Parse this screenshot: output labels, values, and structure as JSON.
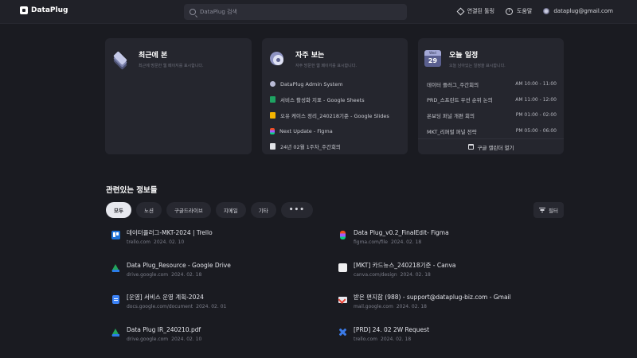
{
  "app": {
    "name": "DataPlug"
  },
  "search": {
    "placeholder": "DataPlug 검색"
  },
  "topnav": {
    "connected_tools": "연결된 툴링",
    "help": "도움말",
    "account": "dataplug@gmail.com"
  },
  "cards": {
    "recent": {
      "title": "최근에 본",
      "subtitle": "최근에 방문한 웹 페이지를 표시합니다."
    },
    "frequent": {
      "title": "자주 보는",
      "subtitle": "자주 방문한 웹 페이지를 표시합니다.",
      "items": [
        {
          "label": "DataPlug Admin System",
          "icon": "system-icon"
        },
        {
          "label": "서비스 활성화 지표 - Google Sheets",
          "icon": "google-sheets-icon"
        },
        {
          "label": "오유 케이스 정리_240218기준 - Google Slides",
          "icon": "google-slides-icon"
        },
        {
          "label": "Next Update - Figma",
          "icon": "figma-icon"
        },
        {
          "label": "24년 02월 1주차_주간회의",
          "icon": "document-icon"
        }
      ]
    },
    "today": {
      "title": "오늘 일정",
      "subtitle": "오늘 남아있는 일정을 표시합니다.",
      "calendar_month": "Wed",
      "calendar_day": "29",
      "events": [
        {
          "name": "데이터 플러그_주간회의",
          "time": "AM 10:00 - 11:00"
        },
        {
          "name": "PRD_스프린트 우선 순위 논의",
          "time": "AM 11:00 - 12:00"
        },
        {
          "name": "온보딩 퍼널 개편 회의",
          "time": "PM 01:00 - 02:00"
        },
        {
          "name": "MKT_리퍼럴 퍼널 전략",
          "time": "PM 05:00 - 06:00"
        }
      ],
      "open_calendar": "구글 캘린더 열기"
    }
  },
  "related": {
    "title": "관련있는 정보들",
    "chips": [
      "모두",
      "노션",
      "구글드라이브",
      "지메일",
      "기타",
      "•••"
    ],
    "active_chip": "모두",
    "filter_label": "필터",
    "results": [
      {
        "title": "데이터플러그-MKT-2024 | Trello",
        "domain": "trello.com",
        "date": "2024. 02. 10",
        "icon": "trello-icon"
      },
      {
        "title": "Data Plug_v0.2_FinalEdit- Figma",
        "domain": "figma.com/file",
        "date": "2024. 02. 18",
        "icon": "figma-icon"
      },
      {
        "title": "Data Plug_Resource - Google Drive",
        "domain": "drive.google.com",
        "date": "2024. 02. 18",
        "icon": "google-drive-icon"
      },
      {
        "title": "[MKT] 카드뉴스_240218기준 - Canva",
        "domain": "canva.com/design",
        "date": "2024. 02. 18",
        "icon": "canva-icon"
      },
      {
        "title": "[운영] 서비스 운영 계획-2024",
        "domain": "docs.google.com/document",
        "date": "2024. 02. 01",
        "icon": "google-docs-icon"
      },
      {
        "title": "받은 편지함 (988) - support@dataplug-biz.com - Gmail",
        "domain": "mail.google.com",
        "date": "2024. 02. 18",
        "icon": "gmail-icon"
      },
      {
        "title": "Data Plug IR_240210.pdf",
        "domain": "drive.google.com",
        "date": "2024. 02. 10",
        "icon": "google-drive-icon"
      },
      {
        "title": "[PRD] 24. 02 2W Request",
        "domain": "trello.com",
        "date": "2024. 02. 18",
        "icon": "jira-icon"
      }
    ]
  }
}
